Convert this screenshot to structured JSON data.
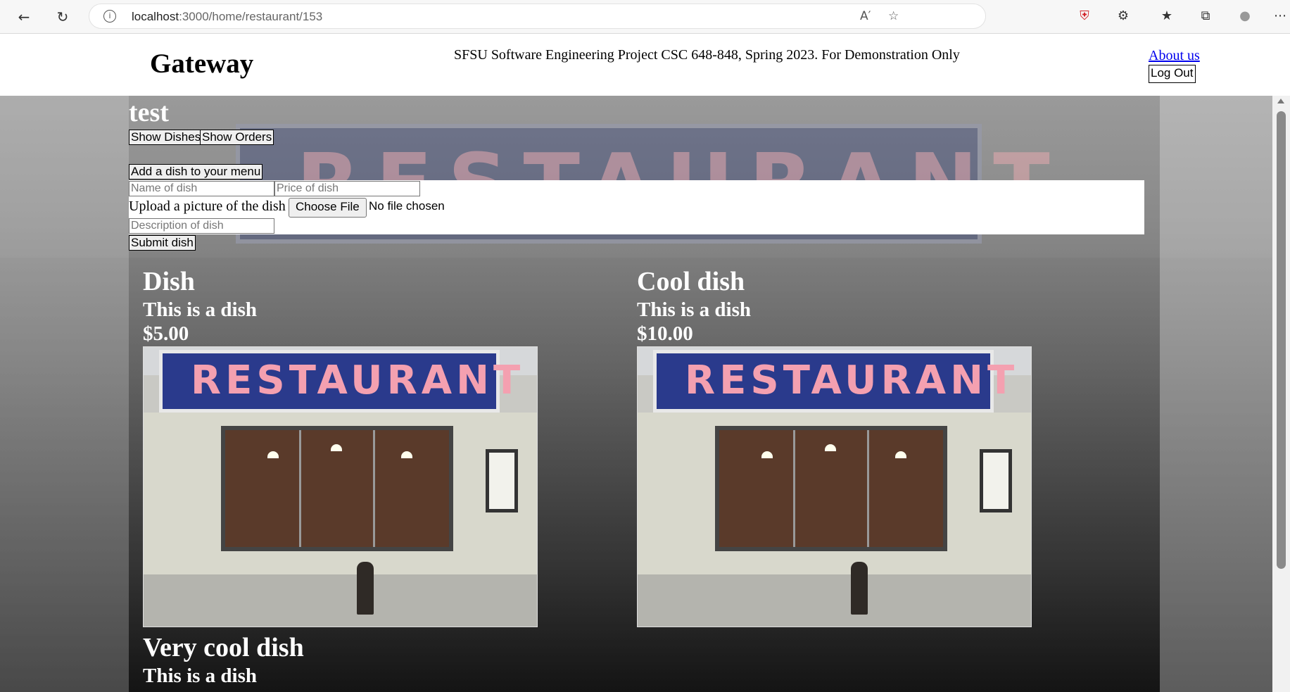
{
  "browser": {
    "url_host": "localhost",
    "url_path": ":3000/home/restaurant/153",
    "icons": [
      "back-icon",
      "reload-icon",
      "info-icon",
      "read-aloud-icon",
      "favorite-add-icon",
      "shield-icon",
      "extensions-icon",
      "favorites-icon",
      "collections-icon",
      "profile-icon",
      "more-icon"
    ]
  },
  "header": {
    "logo": "Gateway",
    "tagline": "SFSU Software Engineering Project CSC 648-848, Spring 2023. For Demonstration Only",
    "about_link": "About us",
    "logout_label": "Log Out"
  },
  "restaurant": {
    "name": "test",
    "show_dishes_label": "Show Dishes",
    "show_orders_label": "Show Orders"
  },
  "form": {
    "add_button_label": "Add a dish to your menu",
    "name_placeholder": "Name of dish",
    "price_placeholder": "Price of dish",
    "upload_label": "Upload a picture of the dish",
    "choose_file_label": "Choose File",
    "no_file_text": "No file chosen",
    "description_placeholder": "Description of dish",
    "submit_label": "Submit dish"
  },
  "dishes": [
    {
      "title": "Dish",
      "description": "This is a dish",
      "price": "$5.00",
      "image_text": "RESTAURANT"
    },
    {
      "title": "Cool dish",
      "description": "This is a dish",
      "price": "$10.00",
      "image_text": "RESTAURANT"
    },
    {
      "title": "Very cool dish",
      "description": "This is a dish"
    }
  ],
  "background": {
    "sign_text": "RESTAURANT"
  }
}
